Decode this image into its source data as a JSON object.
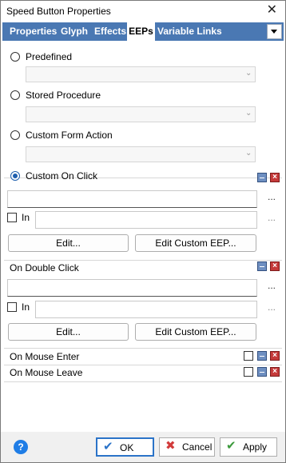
{
  "window": {
    "title": "Speed Button Properties",
    "close_glyph": "✕"
  },
  "tabs": [
    {
      "label": "Properties",
      "active": false
    },
    {
      "label": "Glyph",
      "active": false
    },
    {
      "label": "Effects",
      "active": false
    },
    {
      "label": "EEPs",
      "active": true
    },
    {
      "label": "Variable Links",
      "active": false
    }
  ],
  "radios": {
    "predefined": {
      "label": "Predefined",
      "checked": false
    },
    "stored_procedure": {
      "label": "Stored Procedure",
      "checked": false
    },
    "custom_form_action": {
      "label": "Custom Form Action",
      "checked": false
    },
    "custom_on_click": {
      "label": "Custom On Click",
      "checked": true
    }
  },
  "on_click": {
    "ellipsis": "...",
    "in_label": "In",
    "in_ellipsis": "...",
    "edit_label": "Edit...",
    "edit_custom_label": "Edit Custom EEP..."
  },
  "on_double_click": {
    "label": "On Double Click",
    "ellipsis": "...",
    "in_label": "In",
    "in_ellipsis": "...",
    "edit_label": "Edit...",
    "edit_custom_label": "Edit Custom EEP..."
  },
  "on_mouse_enter": {
    "label": "On Mouse Enter"
  },
  "on_mouse_leave": {
    "label": "On Mouse Leave"
  },
  "footer": {
    "help_glyph": "?",
    "ok_label": "OK",
    "cancel_label": "Cancel",
    "apply_label": "Apply"
  },
  "colors": {
    "tab_strip": "#4a78b3",
    "accent_blue": "#2b73c8",
    "cancel_red": "#d23b3b",
    "apply_green": "#3c9a3c"
  }
}
